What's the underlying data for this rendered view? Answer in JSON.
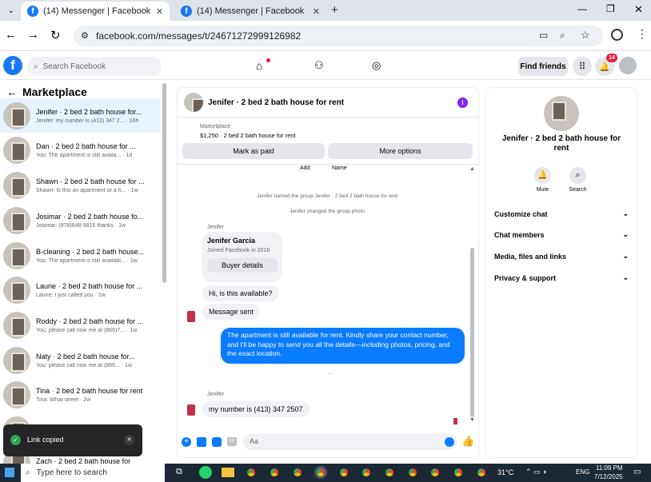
{
  "browser": {
    "tabs": [
      {
        "title": "(14) Messenger | Facebook",
        "active": true
      },
      {
        "title": "(14) Messenger | Facebook",
        "active": false
      }
    ],
    "url": "facebook.com/messages/t/24671272999126982"
  },
  "facebook": {
    "logo": "f",
    "search_placeholder": "Search Facebook",
    "find_friends": "Find friends",
    "notification_count": "14"
  },
  "sidebar": {
    "title": "Marketplace",
    "conversations": [
      {
        "title": "Jenifer · 2 bed 2 bath house for...",
        "preview": "Jenifer: my number is (413) 347 2... · 16h",
        "selected": true
      },
      {
        "title": "Dan · 2 bed 2 bath house for ...",
        "preview": "You: The apartment is still availa... · 1d"
      },
      {
        "title": "Shawn · 2 bed 2 bath house for ...",
        "preview": "Shawn: Is this an apartment or a h... · 1w"
      },
      {
        "title": "Josimar · 2 bed 2 bath house fo...",
        "preview": "Josimar: (978)648-9816 thanks · 1w"
      },
      {
        "title": "B-cleaning · 2 bed 2 bath house...",
        "preview": "You: The apartment is still availabl... · 1w"
      },
      {
        "title": "Laurie · 2 bed 2 bath house for ...",
        "preview": "Laurie: I just called you · 1w"
      },
      {
        "title": "Roddy · 2 bed 2 bath house for ...",
        "preview": "You: please call now me at (866)7... · 1w"
      },
      {
        "title": "Naty · 2 bed 2 bath house for...",
        "preview": "You: please call now me at (866... · 1w"
      },
      {
        "title": "Tina · 2 bed 2 bath house for rent",
        "preview": "Tina: What street · 2w"
      },
      {
        "title": "",
        "preview": ""
      },
      {
        "title": "Zach · 2 bed 2 bath house for",
        "preview": ""
      }
    ],
    "toast": "Link copied"
  },
  "chat": {
    "header_title": "Jenifer · 2 bed 2 bath house for rent",
    "listing_label": "Marketplace",
    "listing_detail": "$1,250 · 2 bed 2 bath house for rent",
    "mark_as_paid": "Mark as paid",
    "more_options": "More options",
    "col_add": "Add",
    "col_name": "Name",
    "sys_1": "Jenifer named the group Jenifer · 2 bed 2 bath house for rent.",
    "sys_2": "Jenifer changed the group photo.",
    "sender_1": "Jenifer",
    "card_name": "Jenifer Garcia",
    "card_joined": "Joined Facebook in 2016",
    "buyer_details": "Buyer details",
    "msg_1": "Hi, is this available?",
    "msg_2": "Message sent",
    "msg_out": "The apartment is still available for rent. Kindly share your contact number, and I'll be happy to send you all the details—including photos, pricing, and the exact location.",
    "sender_2": "Jenifer",
    "msg_3": "my number is (413) 347 2507",
    "composer_placeholder": "Aa"
  },
  "details": {
    "title": "Jenifer · 2 bed 2 bath house for rent",
    "mute": "Mute",
    "search": "Search",
    "sections": [
      "Customize chat",
      "Chat members",
      "Media, files and links",
      "Privacy & support"
    ]
  },
  "taskbar": {
    "search_placeholder": "Type here to search",
    "weather": "31°C",
    "lang": "ENG",
    "time": "11:09 PM",
    "date": "7/12/2025"
  },
  "colors": {
    "brand": "#1877f2",
    "outgoing_bubble": "#0a7cff",
    "sel_row": "#e7f3ff"
  }
}
